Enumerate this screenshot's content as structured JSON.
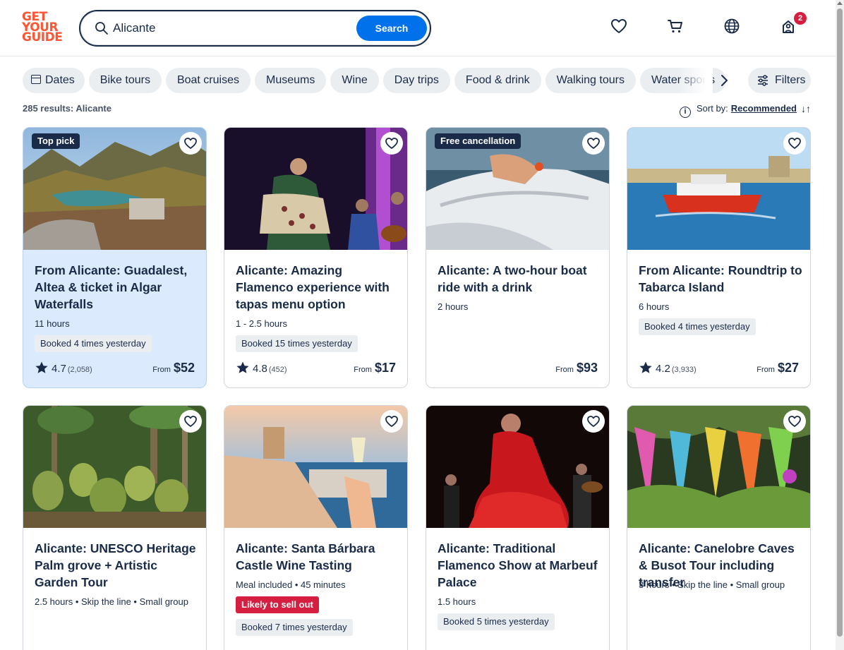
{
  "logo": {
    "lines": [
      "GET",
      "YOUR",
      "GUIDE"
    ],
    "color": "#ff5533"
  },
  "search": {
    "value": "Alicante",
    "placeholder": "Search",
    "button": "Search"
  },
  "header_icons": [
    "heart-icon",
    "cart-icon",
    "globe-icon",
    "profile-icon"
  ],
  "notification_count": "2",
  "chips": [
    "Dates",
    "Bike tours",
    "Boat cruises",
    "Museums",
    "Wine",
    "Day trips",
    "Food & drink",
    "Walking tours",
    "Water sports"
  ],
  "filters_label": "Filters",
  "results_text": "285 results: Alicante",
  "sort": {
    "label": "Sort by:",
    "value": "Recommended"
  },
  "colors": {
    "primary": "#0071eb",
    "text": "#1a2b49",
    "brand": "#ff5533",
    "alert": "#d61f40"
  },
  "cards": [
    {
      "tag": "Top pick",
      "title": "From Alicante: Guadalest, Altea & ticket in Algar Waterfalls",
      "meta": "11 hours",
      "pills": [
        "Booked 4 times yesterday"
      ],
      "rating": "4.7",
      "reviews": "(2,058)",
      "from": "From",
      "price": "$52"
    },
    {
      "tag": "",
      "title": "Alicante: Amazing Flamenco experience with tapas menu option",
      "meta": "1 - 2.5 hours",
      "pills": [
        "Booked 15 times yesterday"
      ],
      "rating": "4.8",
      "reviews": "(452)",
      "from": "From",
      "price": "$17"
    },
    {
      "tag": "Free cancellation",
      "title": "Alicante: A two-hour boat ride with a drink",
      "meta": "2 hours",
      "pills": [],
      "rating": "",
      "reviews": "",
      "from": "From",
      "price": "$93"
    },
    {
      "tag": "",
      "title": "From Alicante: Roundtrip to Tabarca Island",
      "meta": "6 hours",
      "pills": [
        "Booked 4 times yesterday"
      ],
      "rating": "4.2",
      "reviews": "(3,933)",
      "from": "From",
      "price": "$27"
    },
    {
      "tag": "",
      "title": "Alicante: UNESCO Heritage Palm grove + Artistic Garden Tour",
      "meta": "2.5 hours • Skip the line • Small group",
      "pills": [],
      "rating": "",
      "reviews": "",
      "from": "",
      "price": ""
    },
    {
      "tag": "",
      "title": "Alicante: Santa Bárbara Castle Wine Tasting",
      "meta": "Meal included • 45 minutes",
      "pills": [
        "Likely to sell out",
        "Booked 7 times yesterday"
      ],
      "rating": "",
      "reviews": "",
      "from": "",
      "price": ""
    },
    {
      "tag": "",
      "title": "Alicante: Traditional Flamenco Show at Marbeuf Palace",
      "meta": "1.5 hours",
      "pills": [
        "Booked 5 times yesterday"
      ],
      "rating": "",
      "reviews": "",
      "from": "",
      "price": ""
    },
    {
      "tag": "",
      "title": "Alicante: Canelobre Caves & Busot Tour including transfer",
      "meta": "3 hours • Skip the line • Small group",
      "pills": [],
      "rating": "",
      "reviews": "",
      "from": "",
      "price": ""
    }
  ]
}
